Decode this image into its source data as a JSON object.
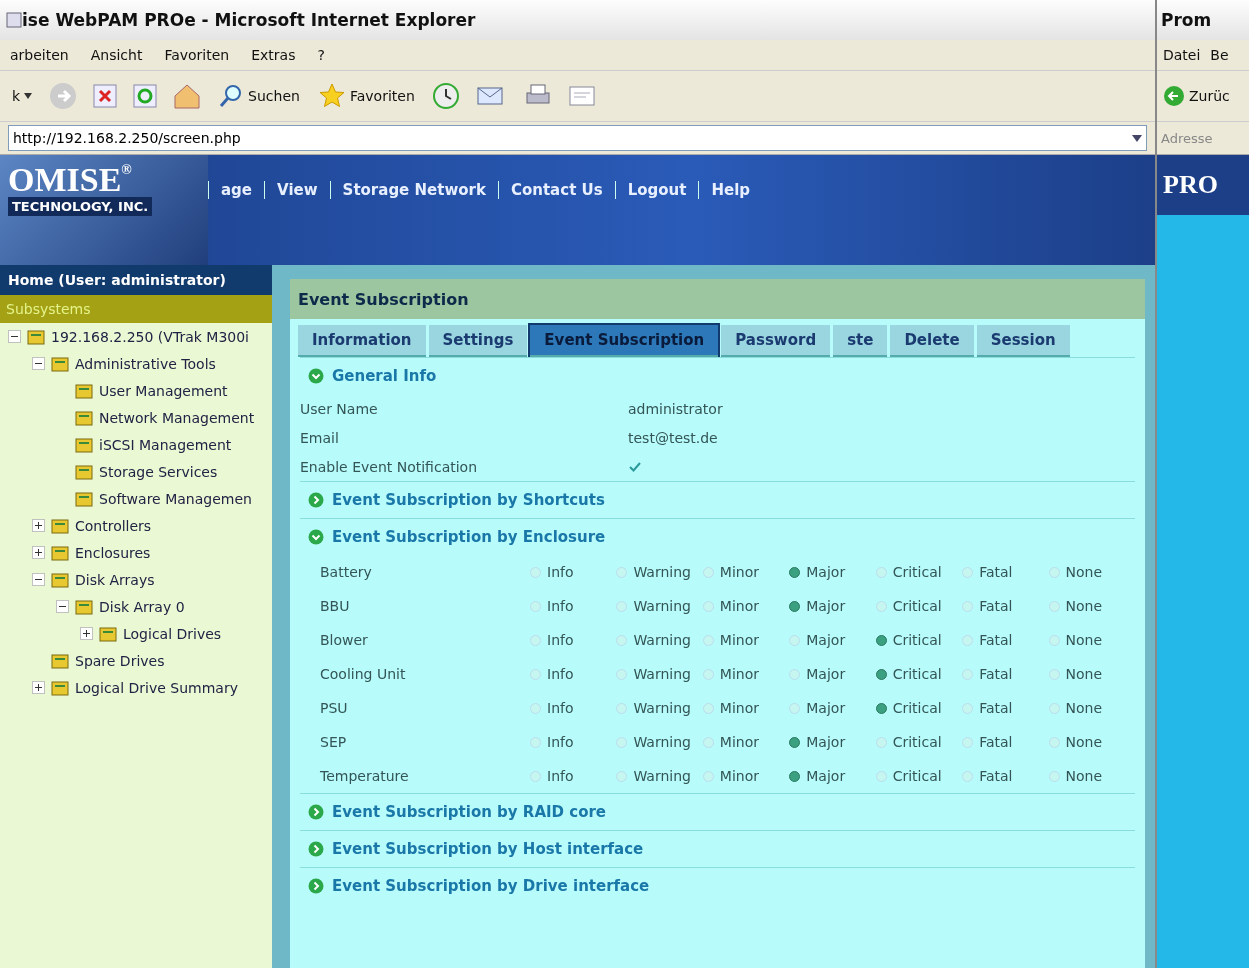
{
  "browser": {
    "title": "ise WebPAM PROe - Microsoft Internet Explorer",
    "menu": [
      "arbeiten",
      "Ansicht",
      "Favoriten",
      "Extras",
      "?"
    ],
    "toolbar": {
      "back": "k",
      "search": "Suchen",
      "favorites": "Favoriten"
    },
    "address": "http://192.168.2.250/screen.php"
  },
  "side_window": {
    "title": "Prom",
    "menu": [
      "Datei",
      "Be"
    ],
    "back": "Zurüc",
    "address_label": "Adresse",
    "logo": "PRO"
  },
  "header": {
    "logo": "OMISE",
    "registered": "®",
    "subtitle": "TECHNOLOGY, INC.",
    "nav": [
      "age",
      "View",
      "Storage Network",
      "Contact Us",
      "Logout",
      "Help"
    ]
  },
  "sidebar": {
    "home": "Home (User: administrator)",
    "root": {
      "label": "Subsystems",
      "selected": true
    },
    "tree": [
      {
        "label": "192.168.2.250 (VTrak M300i",
        "expanded": true,
        "children": [
          {
            "label": "Administrative Tools",
            "expanded": true,
            "children": [
              {
                "label": "User Management"
              },
              {
                "label": "Network Management"
              },
              {
                "label": "iSCSI Management"
              },
              {
                "label": "Storage Services"
              },
              {
                "label": "Software Managemen"
              }
            ]
          },
          {
            "label": "Controllers",
            "expanded": false
          },
          {
            "label": "Enclosures",
            "expanded": false
          },
          {
            "label": "Disk Arrays",
            "expanded": true,
            "children": [
              {
                "label": "Disk Array 0",
                "expanded": true,
                "children": [
                  {
                    "label": "Logical Drives",
                    "expanded": false
                  }
                ]
              }
            ]
          },
          {
            "label": "Spare Drives"
          },
          {
            "label": "Logical Drive Summary",
            "expanded": false
          }
        ]
      }
    ]
  },
  "panel": {
    "title": "Event Subscription",
    "tabs": [
      {
        "label": "Information",
        "selected": false
      },
      {
        "label": "Settings",
        "selected": false
      },
      {
        "label": "Event Subscription",
        "selected": true
      },
      {
        "label": "Password",
        "selected": false
      },
      {
        "label": "ste",
        "selected": false
      },
      {
        "label": "Delete",
        "selected": false
      },
      {
        "label": "Session",
        "selected": false
      }
    ],
    "sections": [
      {
        "kind": "info",
        "title": "General Info",
        "expanded": true,
        "fields": [
          {
            "label": "User Name",
            "value": "administrator"
          },
          {
            "label": "Email",
            "value": "test@test.de"
          },
          {
            "label": "Enable Event Notification",
            "checked": true
          }
        ]
      },
      {
        "title": "Event Subscription by Shortcuts",
        "expanded": false
      },
      {
        "kind": "levels",
        "title": "Event Subscription by Enclosure",
        "expanded": true,
        "rows": [
          {
            "name": "Battery",
            "options": [
              {
                "label": "Info",
                "selected": false
              },
              {
                "label": "Warning",
                "selected": false
              },
              {
                "label": "Minor",
                "selected": false
              },
              {
                "label": "Major",
                "selected": true
              },
              {
                "label": "Critical",
                "selected": false
              },
              {
                "label": "Fatal",
                "selected": false
              },
              {
                "label": "None",
                "selected": false
              }
            ]
          },
          {
            "name": "BBU",
            "options": [
              {
                "label": "Info",
                "selected": false
              },
              {
                "label": "Warning",
                "selected": false
              },
              {
                "label": "Minor",
                "selected": false
              },
              {
                "label": "Major",
                "selected": true
              },
              {
                "label": "Critical",
                "selected": false
              },
              {
                "label": "Fatal",
                "selected": false
              },
              {
                "label": "None",
                "selected": false
              }
            ]
          },
          {
            "name": "Blower",
            "options": [
              {
                "label": "Info",
                "selected": false
              },
              {
                "label": "Warning",
                "selected": false
              },
              {
                "label": "Minor",
                "selected": false
              },
              {
                "label": "Major",
                "selected": false
              },
              {
                "label": "Critical",
                "selected": true
              },
              {
                "label": "Fatal",
                "selected": false
              },
              {
                "label": "None",
                "selected": false
              }
            ]
          },
          {
            "name": "Cooling Unit",
            "options": [
              {
                "label": "Info",
                "selected": false
              },
              {
                "label": "Warning",
                "selected": false
              },
              {
                "label": "Minor",
                "selected": false
              },
              {
                "label": "Major",
                "selected": false
              },
              {
                "label": "Critical",
                "selected": true
              },
              {
                "label": "Fatal",
                "selected": false
              },
              {
                "label": "None",
                "selected": false
              }
            ]
          },
          {
            "name": "PSU",
            "options": [
              {
                "label": "Info",
                "selected": false
              },
              {
                "label": "Warning",
                "selected": false
              },
              {
                "label": "Minor",
                "selected": false
              },
              {
                "label": "Major",
                "selected": false
              },
              {
                "label": "Critical",
                "selected": true
              },
              {
                "label": "Fatal",
                "selected": false
              },
              {
                "label": "None",
                "selected": false
              }
            ]
          },
          {
            "name": "SEP",
            "options": [
              {
                "label": "Info",
                "selected": false
              },
              {
                "label": "Warning",
                "selected": false
              },
              {
                "label": "Minor",
                "selected": false
              },
              {
                "label": "Major",
                "selected": true
              },
              {
                "label": "Critical",
                "selected": false
              },
              {
                "label": "Fatal",
                "selected": false
              },
              {
                "label": "None",
                "selected": false
              }
            ]
          },
          {
            "name": "Temperature",
            "options": [
              {
                "label": "Info",
                "selected": false
              },
              {
                "label": "Warning",
                "selected": false
              },
              {
                "label": "Minor",
                "selected": false
              },
              {
                "label": "Major",
                "selected": true
              },
              {
                "label": "Critical",
                "selected": false
              },
              {
                "label": "Fatal",
                "selected": false
              },
              {
                "label": "None",
                "selected": false
              }
            ]
          }
        ]
      },
      {
        "title": "Event Subscription by RAID core",
        "expanded": false
      },
      {
        "title": "Event Subscription by Host interface",
        "expanded": false
      },
      {
        "title": "Event Subscription by Drive interface",
        "expanded": false
      }
    ]
  }
}
